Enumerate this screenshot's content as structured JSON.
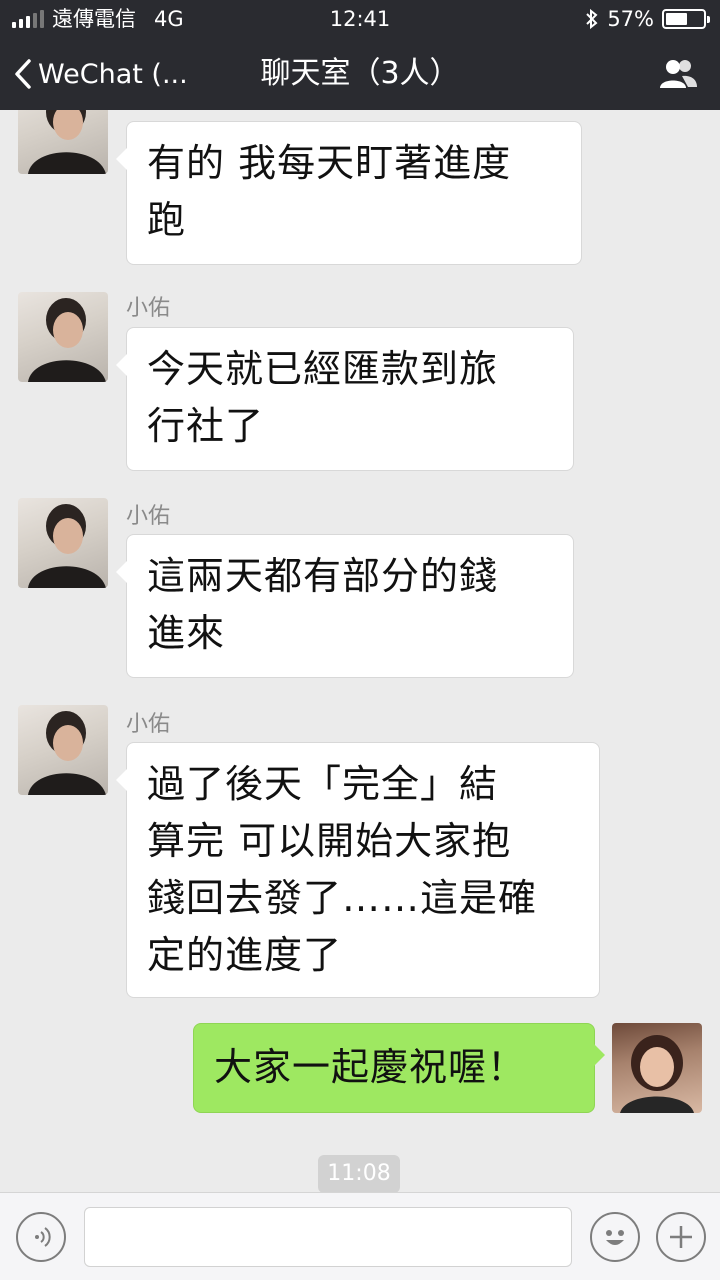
{
  "status_bar": {
    "carrier": "遠傳電信",
    "network": "4G",
    "time": "12:41",
    "bluetooth_icon": "bluetooth-icon",
    "battery_percent": "57%",
    "battery_level": 0.57
  },
  "nav": {
    "back_label": "WeChat (...",
    "title": "聊天室（3人）",
    "people_icon": "group-members-icon"
  },
  "messages": [
    {
      "sender": "",
      "text_lines": [
        "有的 我每天盯著進度",
        "跑"
      ],
      "direction": "in"
    },
    {
      "sender": "小佑",
      "text_lines": [
        "今天就已經匯款到旅",
        "行社了"
      ],
      "direction": "in"
    },
    {
      "sender": "小佑",
      "text_lines": [
        "這兩天都有部分的錢",
        "進來"
      ],
      "direction": "in"
    },
    {
      "sender": "小佑",
      "text_lines": [
        "過了後天「完全」結",
        "算完 可以開始大家抱",
        "錢回去發了……這是確",
        "定的進度了"
      ],
      "direction": "in"
    },
    {
      "sender": "",
      "text_lines": [
        "大家一起慶祝喔！"
      ],
      "direction": "out"
    }
  ],
  "timestamp": "11:08",
  "input_bar": {
    "voice_icon": "voice-icon",
    "emoji_icon": "emoji-icon",
    "plus_icon": "plus-icon",
    "placeholder": ""
  },
  "colors": {
    "bar": "#2a2b30",
    "chat_bg": "#ebebeb",
    "outgoing_bubble": "#9ee861",
    "incoming_bubble": "#ffffff"
  }
}
